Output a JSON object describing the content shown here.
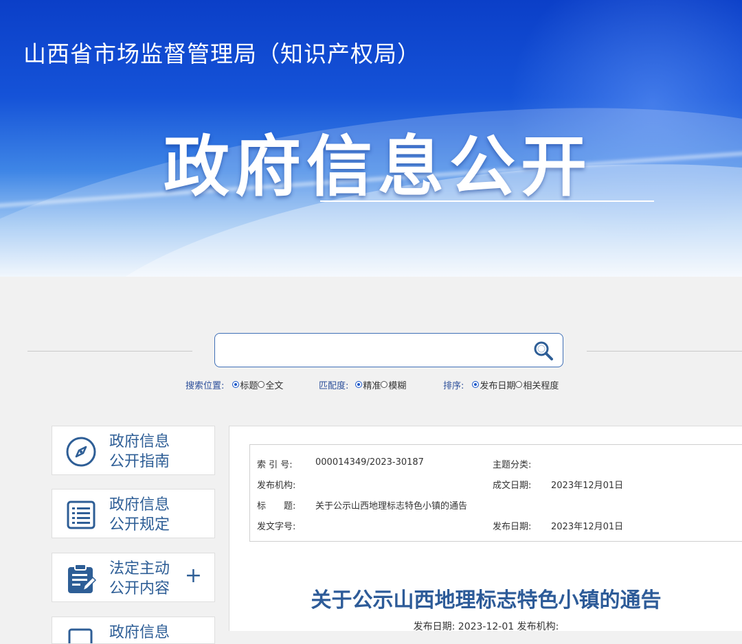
{
  "header": {
    "org_name": "山西省市场监督管理局（知识产权局）",
    "portal_title": "政府信息公开"
  },
  "search": {
    "placeholder": "",
    "position_label": "搜索位置:",
    "position_options": [
      "标题",
      "全文"
    ],
    "position_selected": "标题",
    "match_label": "匹配度:",
    "match_options": [
      "精准",
      "模糊"
    ],
    "match_selected": "精准",
    "sort_label": "排序:",
    "sort_options": [
      "发布日期",
      "相关程度"
    ],
    "sort_selected": "发布日期"
  },
  "sidebar": {
    "items": [
      {
        "line1": "政府信息",
        "line2": "公开指南",
        "icon": "compass-icon"
      },
      {
        "line1": "政府信息",
        "line2": "公开规定",
        "icon": "list-document-icon"
      },
      {
        "line1": "法定主动",
        "line2": "公开内容",
        "icon": "clipboard-edit-icon",
        "expand": "+"
      },
      {
        "line1": "政府信息",
        "line2": "",
        "icon": "document-icon"
      }
    ]
  },
  "meta": {
    "index_no_label": "索 引 号:",
    "index_no": "000014349/2023-30187",
    "topic_label": "主题分类:",
    "topic": "",
    "publisher_label": "发布机构:",
    "publisher": "",
    "created_label": "成文日期:",
    "created": "2023年12月01日",
    "title_label": "标　　题:",
    "title": "关于公示山西地理标志特色小镇的通告",
    "doc_no_label": "发文字号:",
    "doc_no": "",
    "published_label": "发布日期:",
    "published": "2023年12月01日"
  },
  "article": {
    "title": "关于公示山西地理标志特色小镇的通告",
    "sub_line": "发布日期: 2023-12-01 发布机构:"
  },
  "colors": {
    "brand_blue": "#2e5e96",
    "header_blue": "#1553d8",
    "accent_radio": "#1a56c8"
  }
}
